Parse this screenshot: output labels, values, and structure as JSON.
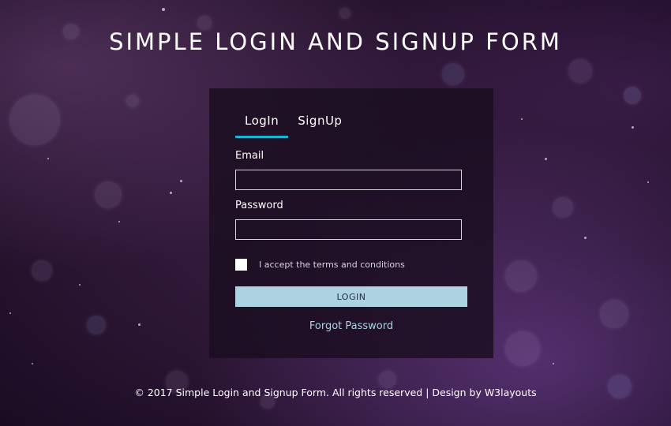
{
  "page": {
    "title": "SIMPLE LOGIN AND SIGNUP FORM",
    "background_accent": "#3a1f44"
  },
  "form": {
    "tabs": [
      {
        "label": "LogIn",
        "active": true
      },
      {
        "label": "SignUp",
        "active": false
      }
    ],
    "tab_underline_color": "#1bb3d4",
    "email": {
      "label": "Email",
      "value": "",
      "placeholder": ""
    },
    "password": {
      "label": "Password",
      "value": "",
      "placeholder": ""
    },
    "terms": {
      "label": "I accept the terms and conditions",
      "checked": false
    },
    "login_button": {
      "label": "LOGIN",
      "color": "#add2e2"
    },
    "forgot_password": "Forgot Password"
  },
  "footer": {
    "text": "© 2017 Simple Login and Signup Form. All rights reserved | Design by W3layouts"
  }
}
